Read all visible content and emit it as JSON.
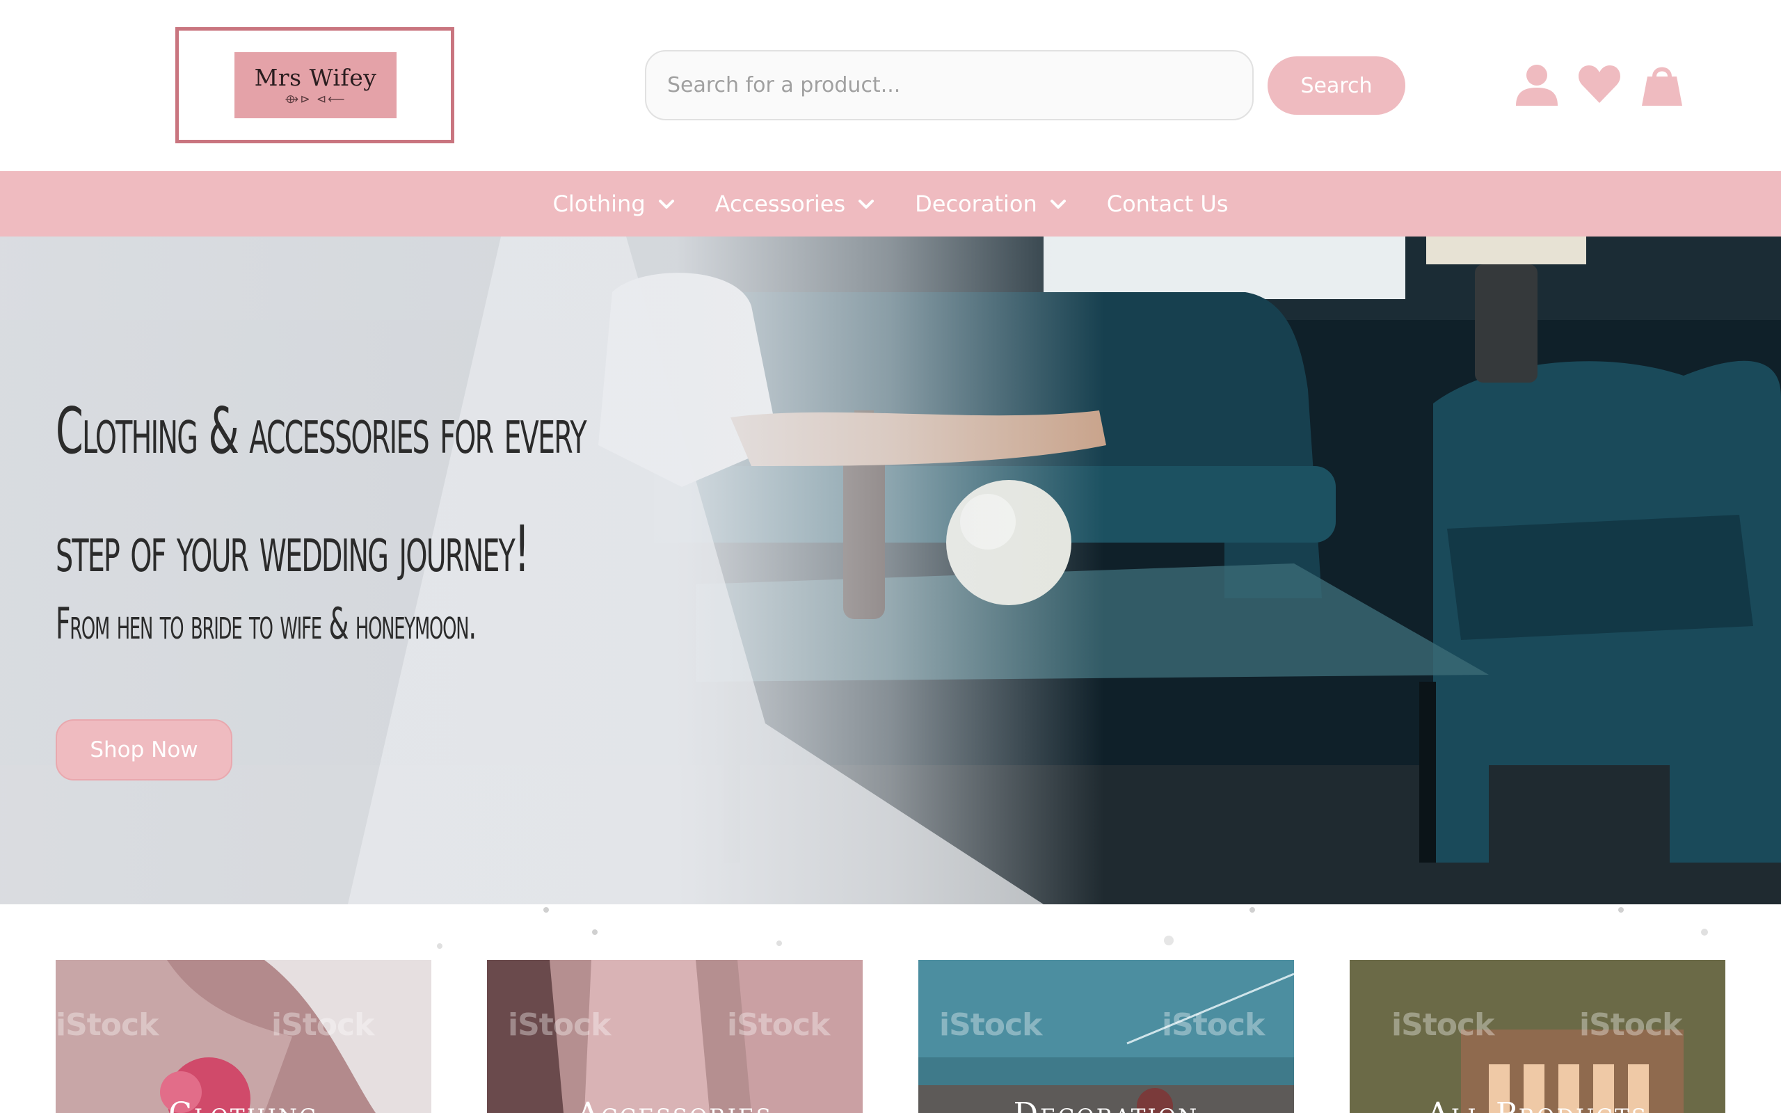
{
  "brand": {
    "name": "Mrs Wifey",
    "ornament": "⟴⊳ ⊲⟵"
  },
  "search": {
    "placeholder": "Search for a product...",
    "button_label": "Search"
  },
  "header_icons": [
    "user-icon",
    "heart-icon",
    "shopping-bag-icon"
  ],
  "nav": {
    "items": [
      {
        "label": "Clothing",
        "has_dropdown": true
      },
      {
        "label": "Accessories",
        "has_dropdown": true
      },
      {
        "label": "Decoration",
        "has_dropdown": true
      },
      {
        "label": "Contact Us",
        "has_dropdown": false
      }
    ]
  },
  "hero": {
    "title_line1": "Clothing & accessories for every",
    "title_line2": "step of your wedding journey!",
    "subtitle": "From hen to bride to wife & honeymoon.",
    "cta_label": "Shop Now"
  },
  "categories": {
    "watermark": "iStock",
    "items": [
      {
        "label": "Clothing"
      },
      {
        "label": "Accessories"
      },
      {
        "label": "Decoration"
      },
      {
        "label": "All Products"
      }
    ]
  },
  "colors": {
    "accent_pink": "#efbbc0",
    "logo_border": "#c9757f",
    "logo_fill": "#e4a2a8",
    "text_dark": "#2b2b2b"
  }
}
